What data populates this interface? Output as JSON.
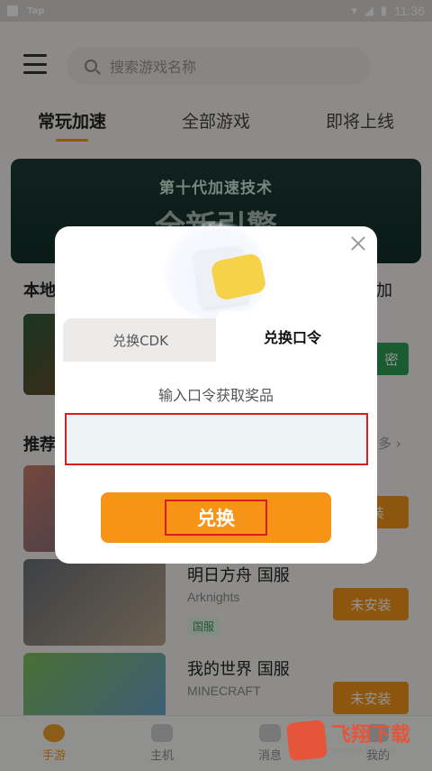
{
  "status_bar": {
    "app_label": "Tap",
    "time": "11:36"
  },
  "header": {
    "search_placeholder": "搜索游戏名称",
    "tabs": [
      {
        "label": "常玩加速",
        "active": true
      },
      {
        "label": "全部游戏",
        "active": false
      },
      {
        "label": "即将上线",
        "active": false
      }
    ]
  },
  "banner": {
    "headline": "第十代加速技术",
    "big_text": "全新引擎"
  },
  "background": {
    "local_section_title": "本地",
    "local_right": "加",
    "open_button": "密",
    "recommend_section_title": "推荐",
    "more_label": "多 ›",
    "games": [
      {
        "name": "",
        "subtitle": "",
        "tag": "",
        "button": "安装"
      },
      {
        "name": "明日方舟 国服",
        "subtitle": "Arknights",
        "tag": "国服",
        "button": "未安装"
      },
      {
        "name": "我的世界 国服",
        "subtitle": "MINECRAFT",
        "tag": "",
        "button": "未安装"
      }
    ]
  },
  "bottom_nav": [
    {
      "label": "手游",
      "active": true
    },
    {
      "label": "主机",
      "active": false
    },
    {
      "label": "消息",
      "active": false
    },
    {
      "label": "我的",
      "active": false
    }
  ],
  "dialog": {
    "tab_cdk": "兑换CDK",
    "tab_code": "兑换口令",
    "prompt": "输入口令获取奖品",
    "input_value": "",
    "redeem_button": "兑换"
  },
  "watermark": {
    "brand": "飞翔下载",
    "url": "www.FXXZ.com"
  },
  "colors": {
    "accent": "#f29419",
    "overlay": "rgba(0,0,0,0.42)",
    "highlight_box": "#d91c1c"
  }
}
